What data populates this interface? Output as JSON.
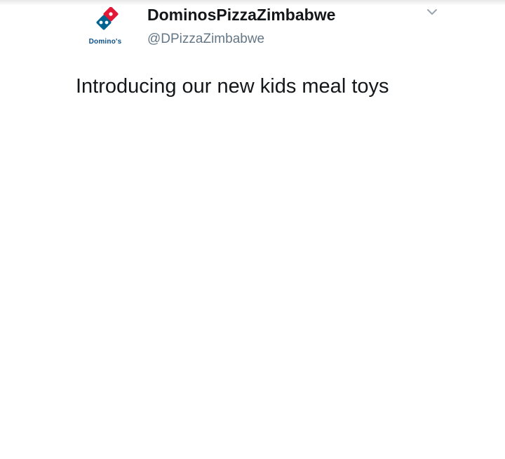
{
  "tweet": {
    "avatar": {
      "brand_text": "Domino's",
      "colors": {
        "blue": "#006491",
        "red": "#e31837",
        "white": "#ffffff"
      }
    },
    "author": {
      "display_name": "DominosPizzaZimbabwe",
      "handle": "@DPizzaZimbabwe"
    },
    "menu_icon": "chevron-down-icon",
    "text": "Introducing our new kids meal toys"
  }
}
